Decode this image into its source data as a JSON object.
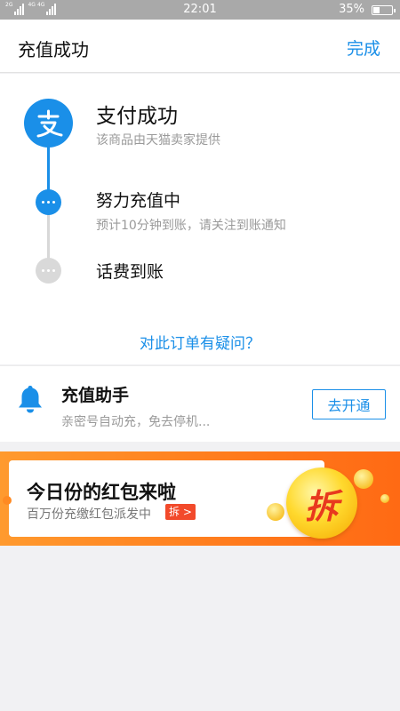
{
  "status_bar": {
    "time": "22:01",
    "battery_percent": "35%",
    "battery_level": 0.35,
    "signal_labels": [
      "2G",
      "4G",
      "4G"
    ]
  },
  "nav": {
    "title": "充值成功",
    "done_label": "完成"
  },
  "progress": {
    "steps": [
      {
        "title": "支付成功",
        "subtitle": "该商品由天猫卖家提供",
        "icon": "alipay-icon",
        "state": "done"
      },
      {
        "title": "努力充值中",
        "subtitle": "预计10分钟到账，请关注到账通知",
        "icon": "ellipsis-icon",
        "state": "active"
      },
      {
        "title": "话费到账",
        "icon": "ellipsis-icon",
        "state": "pending"
      }
    ],
    "question_link": "对此订单有疑问？"
  },
  "assistant": {
    "icon": "bell-icon",
    "title": "充值助手",
    "subtitle": "亲密号自动充，免去停机...",
    "button_label": "去开通"
  },
  "banner": {
    "title": "今日份的红包来啦",
    "subtitle": "百万份充缴红包派发中",
    "tag": "拆 >",
    "coin_text": "拆"
  },
  "colors": {
    "accent": "#1a8fe8",
    "banner_orange": "#ff7a1c",
    "coin_gold": "#ffd92e",
    "tag_red": "#f24a2b"
  }
}
